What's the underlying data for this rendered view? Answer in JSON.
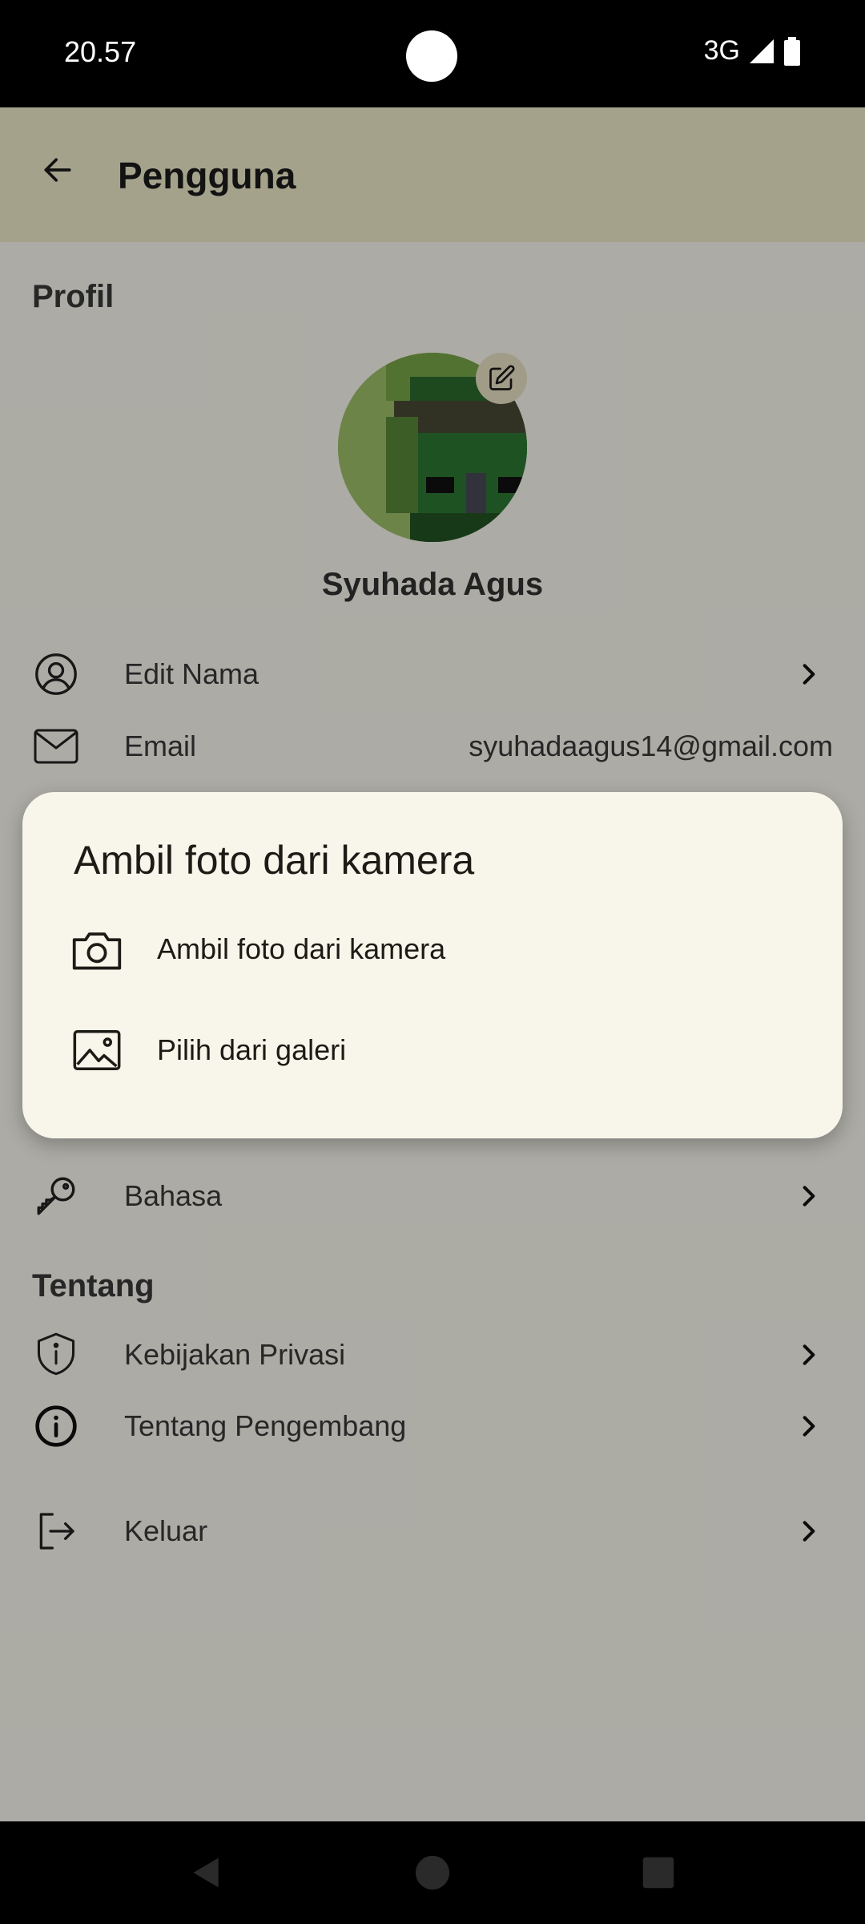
{
  "status_bar": {
    "time": "20.57",
    "network": "3G"
  },
  "app_bar": {
    "title": "Pengguna"
  },
  "profile": {
    "section_title": "Profil",
    "user_name": "Syuhada Agus",
    "items": [
      {
        "label": "Edit Nama",
        "icon": "user-circle-icon"
      },
      {
        "label": "Email",
        "value": "syuhadaagus14@gmail.com",
        "icon": "mail-icon"
      },
      {
        "label": "Bahasa",
        "icon": "key-icon"
      }
    ]
  },
  "about": {
    "section_title": "Tentang",
    "items": [
      {
        "label": "Kebijakan Privasi",
        "icon": "shield-icon"
      },
      {
        "label": "Tentang Pengembang",
        "icon": "info-icon"
      }
    ]
  },
  "logout": {
    "label": "Keluar",
    "icon": "logout-icon"
  },
  "dialog": {
    "title": "Ambil foto dari kamera",
    "options": [
      {
        "label": "Ambil foto dari kamera",
        "icon": "camera-icon"
      },
      {
        "label": "Pilih dari galeri",
        "icon": "image-icon"
      }
    ]
  },
  "colors": {
    "app_bar": "#f3efcf",
    "background": "#fefdf3",
    "dialog": "#f8f6ea",
    "scrim": "rgba(0,0,0,0.32)"
  }
}
